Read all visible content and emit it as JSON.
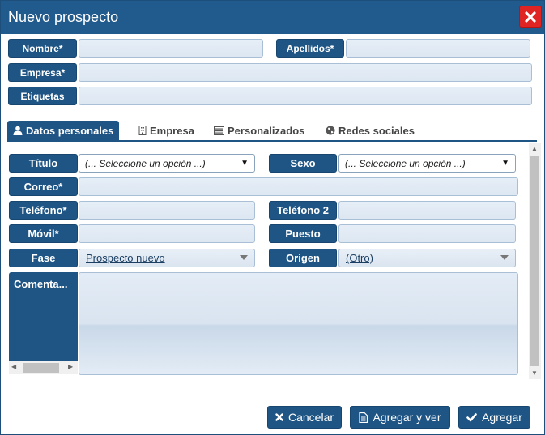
{
  "window": {
    "title": "Nuevo prospecto"
  },
  "header_fields": {
    "nombre_label": "Nombre*",
    "apellidos_label": "Apellidos*",
    "empresa_label": "Empresa*",
    "etiquetas_label": "Etiquetas"
  },
  "tabs": [
    {
      "label": "Datos personales",
      "icon": "user-icon",
      "active": true
    },
    {
      "label": "Empresa",
      "icon": "building-icon",
      "active": false
    },
    {
      "label": "Personalizados",
      "icon": "list-icon",
      "active": false
    },
    {
      "label": "Redes sociales",
      "icon": "globe-icon",
      "active": false
    }
  ],
  "personal": {
    "titulo_label": "Título",
    "titulo_value": "(... Seleccione un opción ...)",
    "sexo_label": "Sexo",
    "sexo_value": "(... Seleccione un opción ...)",
    "correo_label": "Correo*",
    "telefono_label": "Teléfono*",
    "telefono2_label": "Teléfono 2",
    "movil_label": "Móvil*",
    "puesto_label": "Puesto",
    "fase_label": "Fase",
    "fase_value": "Prospecto nuevo",
    "origen_label": "Origen",
    "origen_value": "(Otro)",
    "comentarios_label": "Comenta..."
  },
  "buttons": {
    "cancel": "Cancelar",
    "add_view": "Agregar y ver",
    "add": "Agregar"
  },
  "colors": {
    "primary": "#1f5585",
    "close": "#e02424"
  }
}
